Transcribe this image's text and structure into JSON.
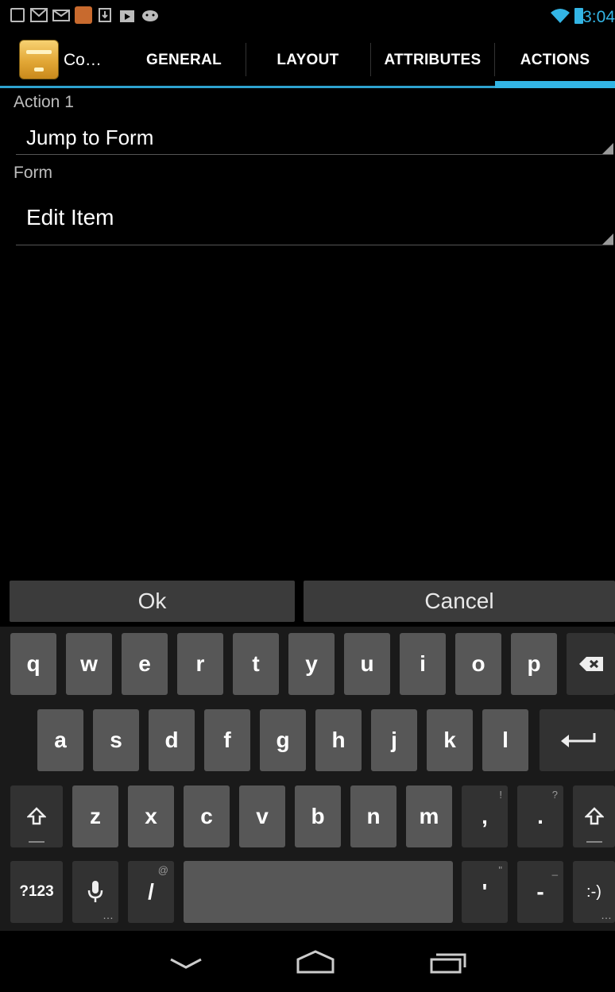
{
  "status_bar": {
    "time": "3:04",
    "notification_icons": [
      "image-icon",
      "gmail-icon",
      "mail-icon",
      "app-photo-icon",
      "download-icon",
      "play-store-icon",
      "android-icon"
    ],
    "wifi_icon": "wifi-icon",
    "battery_icon": "battery-charging-icon"
  },
  "action_bar": {
    "app_title": "Co…",
    "tabs": [
      {
        "label": "GENERAL",
        "selected": false
      },
      {
        "label": "LAYOUT",
        "selected": false
      },
      {
        "label": "ATTRIBUTES",
        "selected": false
      },
      {
        "label": "ACTIONS",
        "selected": true
      }
    ],
    "accent_color": "#33b5e5"
  },
  "form": {
    "action_label": "Action 1",
    "action_value": "Jump to Form",
    "form_label": "Form",
    "form_value": "Edit Item"
  },
  "dialog": {
    "ok_label": "Ok",
    "cancel_label": "Cancel"
  },
  "keyboard": {
    "row1": [
      "q",
      "w",
      "e",
      "r",
      "t",
      "y",
      "u",
      "i",
      "o",
      "p"
    ],
    "row2": [
      "a",
      "s",
      "d",
      "f",
      "g",
      "h",
      "j",
      "k",
      "l"
    ],
    "row3": [
      "z",
      "x",
      "c",
      "v",
      "b",
      "n",
      "m"
    ],
    "comma": ",",
    "comma_sub": "!",
    "period": ".",
    "period_sub": "?",
    "symbols_key": "?123",
    "slash": "/",
    "slash_sub": "@",
    "apostrophe": "'",
    "apostrophe_sub": "\"",
    "dash": "-",
    "dash_sub": "_",
    "smiley": ":-)",
    "icons": [
      "backspace-icon",
      "enter-icon",
      "shift-icon",
      "microphone-icon"
    ]
  },
  "nav_bar": {
    "icons": [
      "back-icon",
      "home-icon",
      "recent-apps-icon"
    ]
  }
}
